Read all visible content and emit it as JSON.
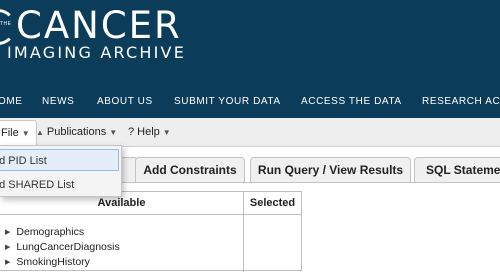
{
  "header": {
    "logo_small": "THE",
    "logo_word": "CANCER",
    "logo_sub": "IMAGING ARCHIVE",
    "nav": [
      "OME",
      "NEWS",
      "ABOUT US",
      "SUBMIT YOUR DATA",
      "ACCESS THE DATA",
      "RESEARCH ACT"
    ]
  },
  "menubar": {
    "file": "File",
    "publications": "Publications",
    "help": "? Help"
  },
  "dropdown": {
    "items": [
      "ad PID List",
      "ad SHARED List"
    ]
  },
  "tabs": [
    "Add Constraints",
    "Run Query / View Results",
    "SQL Statemer"
  ],
  "panel": {
    "col_available": "Available",
    "col_selected": "Selected",
    "tree": [
      "Demographics",
      "LungCancerDiagnosis",
      "SmokingHistory"
    ]
  },
  "colors": {
    "header_bg": "#0b3d5a",
    "menubar_bg": "#eeeeee",
    "dropdown_active": "#e3eef9"
  },
  "icons": [
    "file-caret-down-icon",
    "publications-caret-icon",
    "help-caret-icon",
    "tree-expand-icon"
  ]
}
